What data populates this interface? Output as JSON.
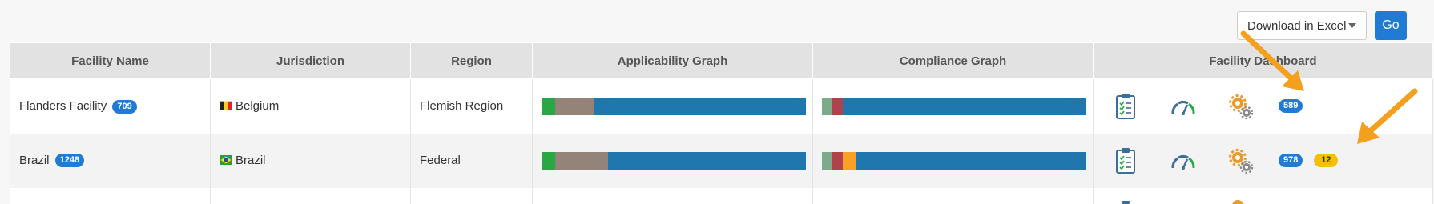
{
  "toolbar": {
    "download_select": "Download in Excel",
    "go_label": "Go"
  },
  "table": {
    "headers": [
      "Facility Name",
      "Jurisdiction",
      "Region",
      "Applicability Graph",
      "Compliance Graph",
      "Facility Dashboard"
    ],
    "rows": [
      {
        "facility": "Flanders Facility",
        "facility_badge": "709",
        "jurisdiction": "Belgium",
        "region": "Flemish Region",
        "applicability": [
          {
            "color": "#28a745",
            "share": 5
          },
          {
            "color": "#938379",
            "share": 15
          },
          {
            "color": "#1f77ad",
            "share": 80
          }
        ],
        "compliance": [
          {
            "color": "#7eaa8c",
            "share": 4
          },
          {
            "color": "#b0424b",
            "share": 4
          },
          {
            "color": "#1f77ad",
            "share": 92
          }
        ],
        "dashboard_badges": [
          {
            "value": "589",
            "color": "#1f7bd4"
          }
        ]
      },
      {
        "facility": "Brazil",
        "facility_badge": "1248",
        "jurisdiction": "Brazil",
        "region": "Federal",
        "applicability": [
          {
            "color": "#28a745",
            "share": 5
          },
          {
            "color": "#938379",
            "share": 20
          },
          {
            "color": "#1f77ad",
            "share": 75
          }
        ],
        "compliance": [
          {
            "color": "#7eaa8c",
            "share": 4
          },
          {
            "color": "#b0424b",
            "share": 4
          },
          {
            "color": "#f7a127",
            "share": 5
          },
          {
            "color": "#1f77ad",
            "share": 87
          }
        ],
        "dashboard_badges": [
          {
            "value": "978",
            "color": "#1f7bd4"
          },
          {
            "value": "12",
            "color": "#f5c000"
          }
        ]
      }
    ]
  },
  "icons": {
    "checklist": "checklist-icon",
    "gauge": "speedometer-icon",
    "gears": "gears-icon",
    "arrow": "annotation-arrow-icon"
  }
}
